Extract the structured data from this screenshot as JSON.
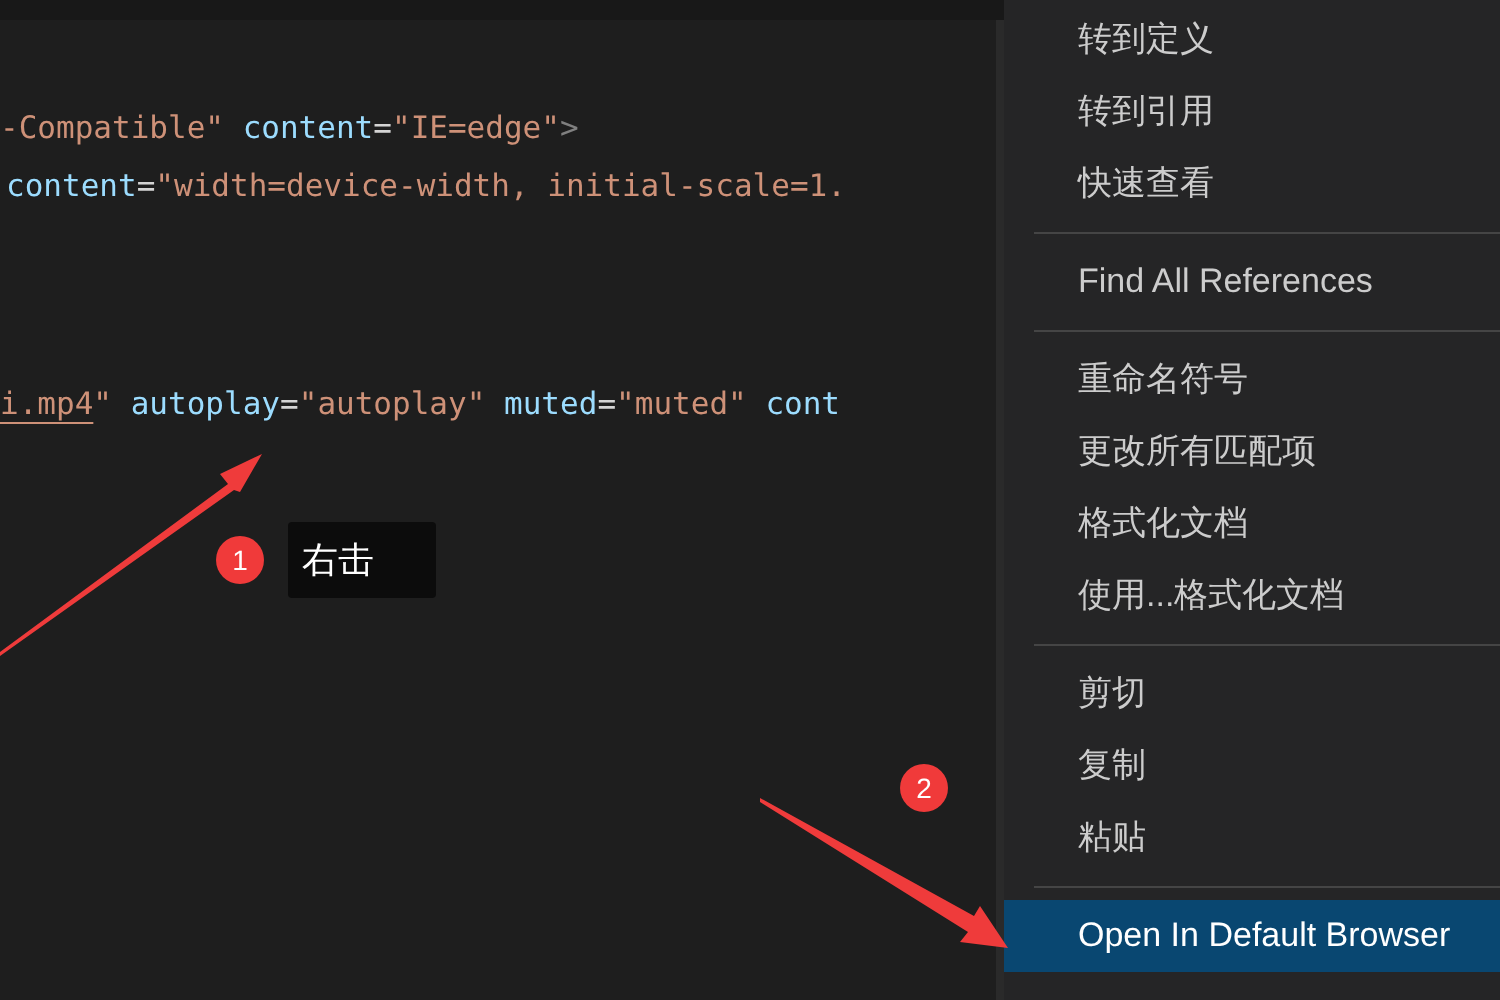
{
  "editor": {
    "lines": [
      {
        "tokens": [
          {
            "text": "-Compatible\"",
            "kind": "string"
          },
          {
            "text": " content",
            "kind": "attr"
          },
          {
            "text": "=",
            "kind": "plain"
          },
          {
            "text": "\"IE=edge\"",
            "kind": "string"
          },
          {
            "text": ">",
            "kind": "punct"
          }
        ]
      },
      {
        "tokens": [
          {
            "text": "content",
            "kind": "attr"
          },
          {
            "text": "=",
            "kind": "plain"
          },
          {
            "text": "\"width=device-width, initial-scale=1.",
            "kind": "string"
          }
        ]
      },
      {
        "tokens": [
          {
            "text": "i.mp4",
            "kind": "link"
          },
          {
            "text": "\"",
            "kind": "string"
          },
          {
            "text": " autoplay",
            "kind": "attr"
          },
          {
            "text": "=",
            "kind": "plain"
          },
          {
            "text": "\"autoplay\"",
            "kind": "string"
          },
          {
            "text": " muted",
            "kind": "attr"
          },
          {
            "text": "=",
            "kind": "plain"
          },
          {
            "text": "\"muted\"",
            "kind": "string"
          },
          {
            "text": " cont",
            "kind": "attr"
          }
        ]
      }
    ]
  },
  "annotations": {
    "badges": [
      "1",
      "2"
    ],
    "tooltip": "右击"
  },
  "context_menu": {
    "groups": [
      [
        {
          "label": "转到定义",
          "selected": false
        },
        {
          "label": "转到引用",
          "selected": false
        },
        {
          "label": "快速查看",
          "selected": false
        }
      ],
      [
        {
          "label": "Find All References",
          "selected": false
        }
      ],
      [
        {
          "label": "重命名符号",
          "selected": false
        },
        {
          "label": "更改所有匹配项",
          "selected": false
        },
        {
          "label": "格式化文档",
          "selected": false
        },
        {
          "label": "使用...格式化文档",
          "selected": false
        }
      ],
      [
        {
          "label": "剪切",
          "selected": false
        },
        {
          "label": "复制",
          "selected": false
        },
        {
          "label": "粘贴",
          "selected": false
        }
      ],
      [
        {
          "label": "Open In Default Browser",
          "selected": true
        }
      ]
    ]
  }
}
